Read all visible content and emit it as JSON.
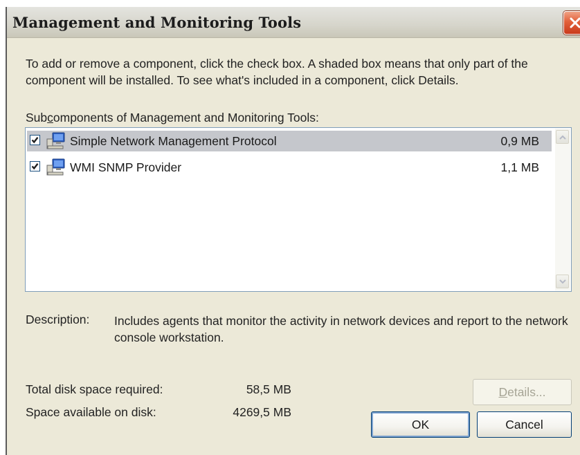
{
  "window": {
    "title": "Management and Monitoring Tools"
  },
  "intro": {
    "text": "To add or remove a component, click the check box. A shaded box means that only part of the component will be installed. To see what's included in a component, click Details."
  },
  "subcomponents": {
    "label_before": "Sub",
    "label_mnemonic": "c",
    "label_after": "omponents of Management and Monitoring Tools:",
    "items": [
      {
        "label": "Simple Network Management Protocol",
        "size": "0,9 MB",
        "checked": true,
        "selected": true,
        "icon": "network-computer-icon"
      },
      {
        "label": "WMI SNMP Provider",
        "size": "1,1 MB",
        "checked": true,
        "selected": false,
        "icon": "network-computer-icon"
      }
    ]
  },
  "description": {
    "label": "Description:",
    "text": "Includes agents that monitor the activity in network devices and report to the network console workstation."
  },
  "disk": {
    "total_label": "Total disk space required:",
    "total_value": "58,5 MB",
    "available_label": "Space available on disk:",
    "available_value": "4269,5 MB"
  },
  "buttons": {
    "details_mnemonic": "D",
    "details_rest": "etails...",
    "ok": "OK",
    "cancel": "Cancel"
  },
  "colors": {
    "dialog_bg": "#ece9d8",
    "selection": "#c5c7cc",
    "close_button": "#e2603a",
    "focus_border": "#7da2ce"
  }
}
